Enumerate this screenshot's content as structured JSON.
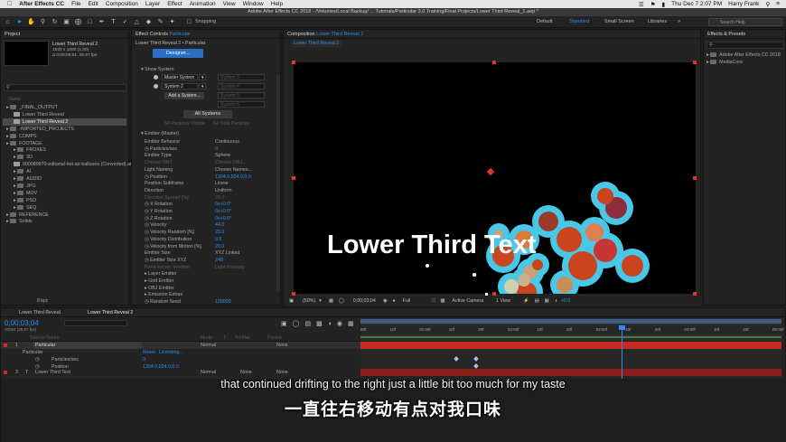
{
  "menubar": {
    "app_name": "After Effects CC",
    "items": [
      "File",
      "Edit",
      "Composition",
      "Layer",
      "Effect",
      "Animation",
      "View",
      "Window",
      "Help"
    ],
    "clock": "Thu Dec 7  2:07 PM",
    "user": "Harry Frank"
  },
  "window": {
    "title": "Adobe After Effects CC 2018 - /Volumes/Local Backup/ ... Tutorials/Particular 3.0 Training/Final Projects/Lower Third Reveal_1.aep *"
  },
  "toolbar": {
    "snapping_label": "Snapping",
    "workspaces": [
      "Default",
      "Standard",
      "Small Screen",
      "Libraries"
    ],
    "active_workspace": "Standard",
    "search_placeholder": "Search Help"
  },
  "project": {
    "tab": "Project",
    "comp_name": "Lower Third Reveal 2",
    "comp_info": [
      "1920 x 1080 (1.00)",
      "Δ 0;00;05;01, 29.97 fps"
    ],
    "col_name": "Name",
    "items": [
      {
        "label": "_FINAL_OUTPUT",
        "type": "folder",
        "level": 0
      },
      {
        "label": "Lower Third Reveal",
        "type": "comp",
        "level": 1
      },
      {
        "label": "Lower Third Reveal 2",
        "type": "comp",
        "level": 1,
        "selected": true
      },
      {
        "label": "-IMPORTED_PROJECTS",
        "type": "folder",
        "level": 0
      },
      {
        "label": "COMPS",
        "type": "folder",
        "level": 0
      },
      {
        "label": "FOOTAGE",
        "type": "folder",
        "level": 0
      },
      {
        "label": "FROXES",
        "type": "folder",
        "level": 1
      },
      {
        "label": "3D",
        "type": "folder",
        "level": 1
      },
      {
        "label": "000089970-editorial-hot-air-balloons (Converted).ai",
        "type": "file",
        "level": 1
      },
      {
        "label": "AI",
        "type": "folder",
        "level": 1
      },
      {
        "label": "AUDIO",
        "type": "folder",
        "level": 1
      },
      {
        "label": "JPG",
        "type": "folder",
        "level": 1
      },
      {
        "label": "MOV",
        "type": "folder",
        "level": 1
      },
      {
        "label": "PSD",
        "type": "folder",
        "level": 1
      },
      {
        "label": "SEQ",
        "type": "folder",
        "level": 1
      },
      {
        "label": "REFERENCE",
        "type": "folder",
        "level": 0
      },
      {
        "label": "Solids",
        "type": "folder",
        "level": 0
      }
    ],
    "bpc": "8 bpc"
  },
  "effects": {
    "tab_prefix": "Effect Controls",
    "tab_layer": "Particular",
    "breadcrumb": "Lower Third Reveal 2 • Particular",
    "designer_button": "Designer...",
    "show_system_label": "Show System",
    "systems": [
      "Master System",
      "System 2"
    ],
    "systems_dim": [
      "System 3",
      "System 4",
      "System 5",
      "System 6"
    ],
    "add_system_button": "Add a System...",
    "all_systems_button": "All Systems",
    "particles_visible": "54 Particles Visible",
    "particles_total": "54 Total Particles",
    "emitter_header": "Emitter (Master)",
    "props": [
      {
        "name": "Emitter Behavior",
        "value": "Continuous"
      },
      {
        "name": "Particles/sec",
        "value": "0",
        "blue": true
      },
      {
        "name": "Emitter Type",
        "value": "Sphere"
      },
      {
        "name": "Choose OBJ",
        "value": "Choose OBJ...",
        "dim": true
      },
      {
        "name": "Light Naming",
        "value": "Choose Names..."
      },
      {
        "name": "Position",
        "value": "1304.0,924.0,0.0",
        "blue": true
      },
      {
        "name": "Position Subframe",
        "value": "Linear"
      },
      {
        "name": "Direction",
        "value": "Uniform"
      },
      {
        "name": "Direction Spread [%]",
        "value": "20.0",
        "dim": true
      },
      {
        "name": "X Rotation",
        "value": "0x+0.0°",
        "blue": true
      },
      {
        "name": "Y Rotation",
        "value": "0x+0.0°",
        "blue": true
      },
      {
        "name": "Z Rotation",
        "value": "0x+0.0°",
        "blue": true
      },
      {
        "name": "Velocity",
        "value": "44.0",
        "blue": true
      },
      {
        "name": "Velocity Random [%]",
        "value": "20.0",
        "blue": true
      },
      {
        "name": "Velocity Distribution",
        "value": "0.5",
        "blue": true
      },
      {
        "name": "Velocity from Motion [%]",
        "value": "20.0",
        "blue": true
      },
      {
        "name": "Emitter Size",
        "value": "XYZ Linked"
      },
      {
        "name": "Emitter Size XYZ",
        "value": "248",
        "blue": true
      },
      {
        "name": "Particles/sec modifier",
        "value": "Light Intensity",
        "dim": true
      },
      {
        "name": "Layer Emitter",
        "value": ""
      },
      {
        "name": "Grid Emitter",
        "value": ""
      },
      {
        "name": "OBJ Emitter",
        "value": ""
      },
      {
        "name": "Emission Extras",
        "value": ""
      },
      {
        "name": "Random Seed",
        "value": "100000",
        "blue": true
      }
    ]
  },
  "composition": {
    "tab_prefix": "Composition",
    "tab_name": "Lower Third Reveal 2",
    "sub_tab": "Lower Third Reveal 2",
    "overlay_text": "Lower Third Text",
    "zoom": "(50%)",
    "timecode": "0;00;03;04",
    "resolution": "Full",
    "camera": "Active Camera",
    "views": "1 View",
    "exposure": "+0.0"
  },
  "effects_presets": {
    "tab": "Effects & Presets",
    "items": [
      "Adobe After Effects CC 2018",
      "MediaCore"
    ]
  },
  "timeline": {
    "tabs": [
      "Lower Third Reveal",
      "Lower Third Reveal 2"
    ],
    "active_tab": "Lower Third Reveal 2",
    "current_time": "0;00;03;04",
    "frame_info": "00094 (29.97 fps)",
    "columns": [
      "Source Name",
      "Mode",
      "T",
      "TrkMat",
      "Parent"
    ],
    "ruler": [
      "00f",
      "10f",
      "01:00f",
      "10f",
      "20f",
      "02:00f",
      "10f",
      "20f",
      "03:00f",
      "10f",
      "20f",
      "04:00f",
      "10f",
      "20f",
      "05:00f"
    ],
    "layers": [
      {
        "num": "1",
        "name": "Particular",
        "mode": "Normal",
        "trkmat": "",
        "parent": "None",
        "color": "#d8281f"
      },
      {
        "num": "",
        "name": "Particular",
        "mode": "",
        "trkmat": "",
        "parent": "",
        "color": "#4a8f2c"
      },
      {
        "num": "",
        "name": "Particles/sec",
        "value": "0"
      },
      {
        "num": "",
        "name": "Position",
        "value": "1304.0,924.0,0.0"
      },
      {
        "num": "3",
        "name": "Lower Third Text",
        "mode": "Normal",
        "trkmat": "None",
        "parent": "None",
        "color": "#d8281f"
      }
    ],
    "effect_links": [
      "Reset",
      "Licensing..."
    ]
  },
  "subtitles": {
    "english": "that continued drifting to  the right just a little bit too much for my taste",
    "chinese": "一直往右移动有点对我口味"
  },
  "colors": {
    "accent": "#2d8ceb",
    "bubble_fill": "#c9441f",
    "bubble_ring": "#48c8e8"
  }
}
